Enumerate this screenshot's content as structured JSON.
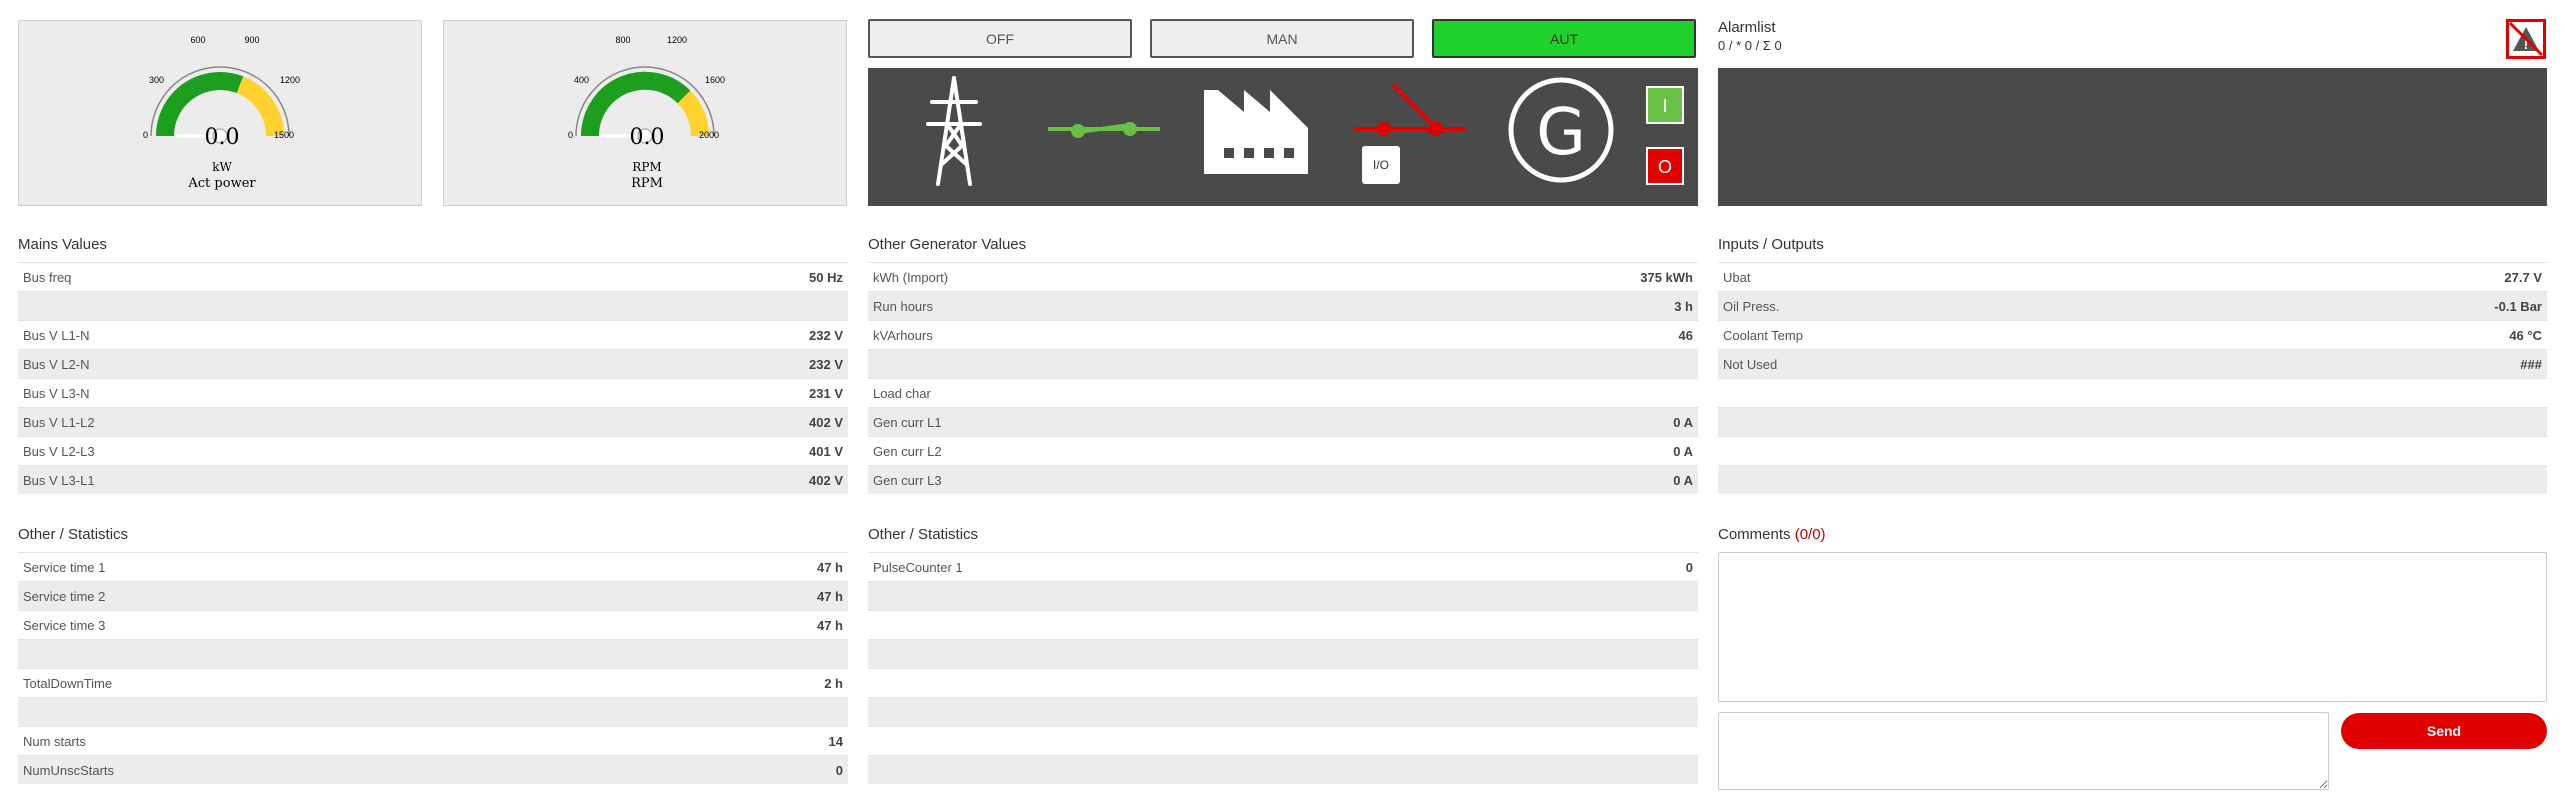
{
  "gauges": [
    {
      "scale": [
        "0",
        "300",
        "600",
        "900",
        "1200",
        "1500"
      ],
      "max": 1500,
      "value_text": "0.0",
      "value": 0,
      "unit": "kW",
      "label": "Act power"
    },
    {
      "scale": [
        "0",
        "400",
        "800",
        "1200",
        "1600",
        "2000"
      ],
      "max": 2000,
      "value_text": "0.0",
      "value": 0,
      "unit": "RPM",
      "label": "RPM"
    }
  ],
  "mode_buttons": {
    "off": "OFF",
    "man": "MAN",
    "aut": "AUT",
    "active": "aut",
    "active_color": "#1fd12a"
  },
  "mimic": {
    "io_label": "I/O",
    "gen_letter": "G",
    "start_label": "I",
    "stop_label": "O",
    "mains_breaker_color": "#6abf45",
    "gen_breaker_color": "#e00000",
    "icons": [
      "transmission-tower-icon",
      "breaker-closed-icon",
      "factory-icon",
      "breaker-open-icon",
      "generator-icon"
    ]
  },
  "alarm": {
    "title": "Alarmlist",
    "count": "0 / * 0 / Σ 0",
    "icon": "alarm-warning-icon"
  },
  "mains_values": {
    "title": "Mains Values",
    "rows": [
      {
        "label": "Bus freq",
        "value": "50 Hz"
      },
      {
        "label": "",
        "value": ""
      },
      {
        "label": "Bus V L1-N",
        "value": "232 V"
      },
      {
        "label": "Bus V L2-N",
        "value": "232 V"
      },
      {
        "label": "Bus V L3-N",
        "value": "231 V"
      },
      {
        "label": "Bus V L1-L2",
        "value": "402 V"
      },
      {
        "label": "Bus V L2-L3",
        "value": "401 V"
      },
      {
        "label": "Bus V L3-L1",
        "value": "402 V"
      }
    ]
  },
  "generator_values": {
    "title": "Other Generator Values",
    "rows": [
      {
        "label": "kWh (Import)",
        "value": "375 kWh"
      },
      {
        "label": "Run hours",
        "value": "3 h"
      },
      {
        "label": "kVArhours",
        "value": "46"
      },
      {
        "label": "",
        "value": ""
      },
      {
        "label": "Load char",
        "value": ""
      },
      {
        "label": "Gen curr L1",
        "value": "0 A"
      },
      {
        "label": "Gen curr L2",
        "value": "0 A"
      },
      {
        "label": "Gen curr L3",
        "value": "0 A"
      }
    ]
  },
  "io_values": {
    "title": "Inputs / Outputs",
    "rows": [
      {
        "label": "Ubat",
        "value": "27.7 V"
      },
      {
        "label": "Oil Press.",
        "value": "-0.1 Bar"
      },
      {
        "label": "Coolant Temp",
        "value": "46 °C"
      },
      {
        "label": "Not Used",
        "value": "###"
      },
      {
        "label": "",
        "value": ""
      },
      {
        "label": "",
        "value": ""
      },
      {
        "label": "",
        "value": ""
      },
      {
        "label": "",
        "value": ""
      }
    ]
  },
  "stats_left": {
    "title": "Other / Statistics",
    "rows": [
      {
        "label": "Service time 1",
        "value": "47 h"
      },
      {
        "label": "Service time 2",
        "value": "47 h"
      },
      {
        "label": "Service time 3",
        "value": "47 h"
      },
      {
        "label": "",
        "value": ""
      },
      {
        "label": "TotalDownTime",
        "value": "2 h"
      },
      {
        "label": "",
        "value": ""
      },
      {
        "label": "Num starts",
        "value": "14"
      },
      {
        "label": "NumUnscStarts",
        "value": "0"
      }
    ]
  },
  "stats_mid": {
    "title": "Other / Statistics",
    "rows": [
      {
        "label": "PulseCounter 1",
        "value": "0"
      },
      {
        "label": "",
        "value": ""
      },
      {
        "label": "",
        "value": ""
      },
      {
        "label": "",
        "value": ""
      },
      {
        "label": "",
        "value": ""
      },
      {
        "label": "",
        "value": ""
      },
      {
        "label": "",
        "value": ""
      },
      {
        "label": "",
        "value": ""
      }
    ]
  },
  "comments": {
    "title": "Comments",
    "count": "(0/0)",
    "send_label": "Send"
  }
}
